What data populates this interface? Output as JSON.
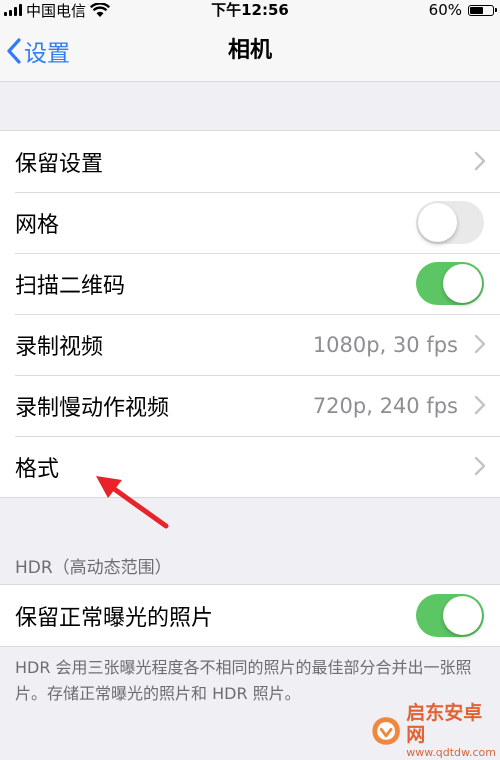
{
  "status_bar": {
    "carrier": "中国电信",
    "time": "下午12:56",
    "battery_percent": "60%",
    "battery_level": 0.6
  },
  "nav": {
    "back_label": "设置",
    "title": "相机"
  },
  "groups": {
    "main": {
      "rows": [
        {
          "label": "保留设置"
        },
        {
          "label": "网格",
          "switch_on": false
        },
        {
          "label": "扫描二维码",
          "switch_on": true
        },
        {
          "label": "录制视频",
          "value": "1080p, 30 fps"
        },
        {
          "label": "录制慢动作视频",
          "value": "720p, 240 fps"
        },
        {
          "label": "格式"
        }
      ]
    },
    "hdr": {
      "header": "HDR（高动态范围）",
      "rows": [
        {
          "label": "保留正常曝光的照片",
          "switch_on": true
        }
      ],
      "footer": "HDR 会用三张曝光程度各不相同的照片的最佳部分合并出一张照片。存储正常曝光的照片和 HDR 照片。"
    }
  },
  "colors": {
    "accent": "#2f7cf6",
    "switch_on": "#5cc665",
    "switch_off": "#e9e9ea",
    "background": "#efeff4",
    "annotation_arrow": "#e8232a"
  },
  "watermark": {
    "name": "启东安卓网",
    "url": "www.qdtdw.com"
  }
}
